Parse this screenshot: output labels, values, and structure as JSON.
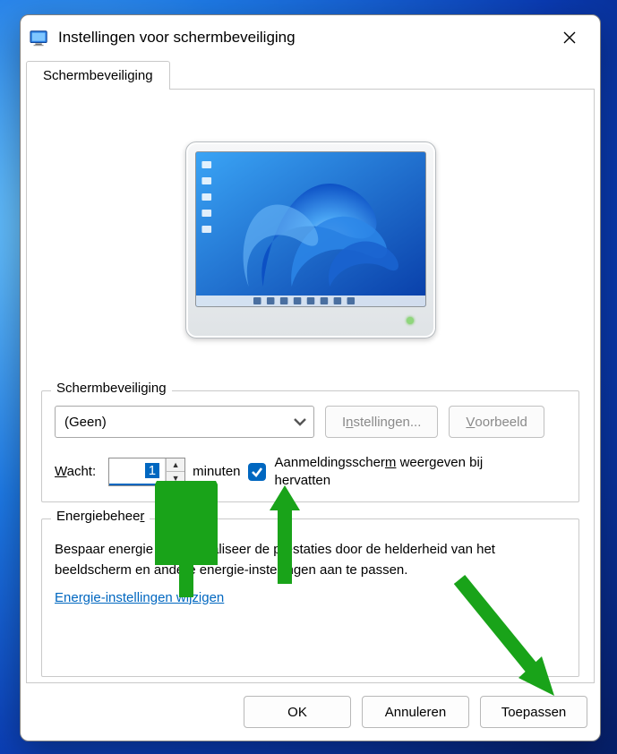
{
  "window": {
    "title": "Instellingen voor schermbeveiliging"
  },
  "tabs": {
    "screensaver": "Schermbeveiliging"
  },
  "group_screensaver": {
    "legend": "Schermbeveiliging",
    "dropdown_value": "(Geen)",
    "settings_button": "Instellingen...",
    "preview_button": "Voorbeeld",
    "wait_label_pre": "W",
    "wait_label_post": "acht:",
    "wait_value": "1",
    "minutes_label": "minuten",
    "resume_checkbox_checked": true,
    "resume_label_line1_pre": "Aanmeldingsscher",
    "resume_label_u": "m",
    "resume_label_line1_post": " weergeven bij",
    "resume_label_line2": "hervatten"
  },
  "group_energy": {
    "legend_pre": "Energiebehee",
    "legend_u": "r",
    "text": "Bespaar energie of maximaliseer de prestaties door de helderheid van het beeldscherm en andere energie-instellingen aan te passen.",
    "link": "Energie-instellingen wijzigen"
  },
  "buttons": {
    "ok": "OK",
    "cancel": "Annuleren",
    "apply": "Toepassen"
  },
  "annotations": {
    "arrow_color": "#2ca02c"
  }
}
